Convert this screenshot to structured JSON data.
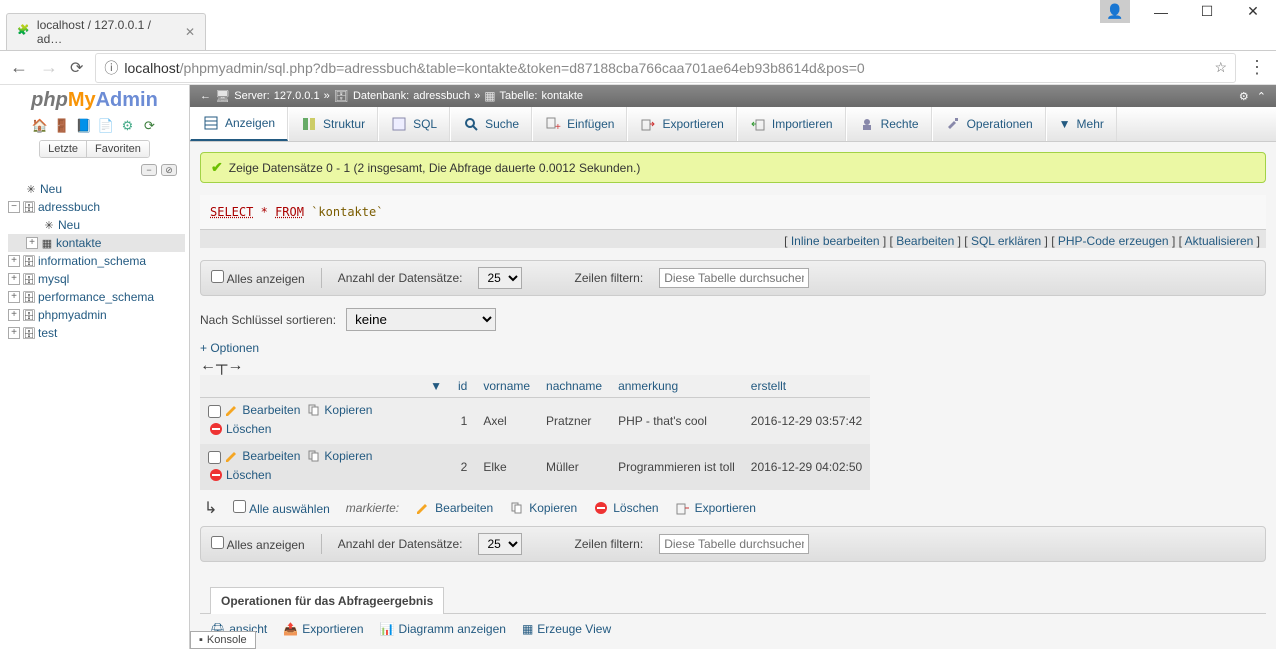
{
  "browser": {
    "tab_title": "localhost / 127.0.0.1 / ad…",
    "url_host": "localhost",
    "url_path": "/phpmyadmin/sql.php?db=adressbuch&table=kontakte&token=d87188cba766caa701ae64eb93b8614d&pos=0"
  },
  "sidebar": {
    "recent": "Letzte",
    "favorites": "Favoriten",
    "tree": [
      {
        "label": "Neu",
        "icon": "new",
        "indent": 0,
        "expander": ""
      },
      {
        "label": "adressbuch",
        "icon": "db",
        "indent": 0,
        "expander": "−"
      },
      {
        "label": "Neu",
        "icon": "new",
        "indent": 1,
        "expander": ""
      },
      {
        "label": "kontakte",
        "icon": "table",
        "indent": 1,
        "expander": "+",
        "selected": true
      },
      {
        "label": "information_schema",
        "icon": "db",
        "indent": 0,
        "expander": "+"
      },
      {
        "label": "mysql",
        "icon": "db",
        "indent": 0,
        "expander": "+"
      },
      {
        "label": "performance_schema",
        "icon": "db",
        "indent": 0,
        "expander": "+"
      },
      {
        "label": "phpmyadmin",
        "icon": "db",
        "indent": 0,
        "expander": "+"
      },
      {
        "label": "test",
        "icon": "db",
        "indent": 0,
        "expander": "+"
      }
    ]
  },
  "breadcrumb": {
    "server_lbl": "Server:",
    "server": "127.0.0.1",
    "db_lbl": "Datenbank:",
    "db": "adressbuch",
    "table_lbl": "Tabelle:",
    "table": "kontakte"
  },
  "tabs": {
    "browse": "Anzeigen",
    "structure": "Struktur",
    "sql": "SQL",
    "search": "Suche",
    "insert": "Einfügen",
    "export": "Exportieren",
    "import": "Importieren",
    "privileges": "Rechte",
    "operations": "Operationen",
    "more": "Mehr"
  },
  "success": "Zeige Datensätze 0 - 1 (2 insgesamt, Die Abfrage dauerte 0.0012 Sekunden.)",
  "sql_query": {
    "select": "SELECT",
    "star": "*",
    "from": "FROM",
    "table": "`kontakte`"
  },
  "sql_actions": {
    "inline": "Inline bearbeiten",
    "edit": "Bearbeiten",
    "explain": "SQL erklären",
    "php": "PHP-Code erzeugen",
    "refresh": "Aktualisieren"
  },
  "controls": {
    "show_all": "Alles anzeigen",
    "rows_label": "Anzahl der Datensätze:",
    "rows_value": "25",
    "filter_label": "Zeilen filtern:",
    "filter_placeholder": "Diese Tabelle durchsuchen",
    "sort_label": "Nach Schlüssel sortieren:",
    "sort_value": "keine",
    "options": "+ Optionen"
  },
  "table": {
    "headers": {
      "id": "id",
      "vorname": "vorname",
      "nachname": "nachname",
      "anmerkung": "anmerkung",
      "erstellt": "erstellt"
    },
    "actions": {
      "edit": "Bearbeiten",
      "copy": "Kopieren",
      "delete": "Löschen"
    },
    "rows": [
      {
        "id": "1",
        "vorname": "Axel",
        "nachname": "Pratzner",
        "anmerkung": "PHP - that's cool",
        "erstellt": "2016-12-29 03:57:42"
      },
      {
        "id": "2",
        "vorname": "Elke",
        "nachname": "Müller",
        "anmerkung": "Programmieren ist toll",
        "erstellt": "2016-12-29 04:02:50"
      }
    ]
  },
  "bulk": {
    "check_all": "Alle auswählen",
    "marked": "markierte:",
    "edit": "Bearbeiten",
    "copy": "Kopieren",
    "delete": "Löschen",
    "export": "Exportieren"
  },
  "result_ops": {
    "title": "Operationen für das Abfrageergebnis",
    "print": "ansicht",
    "export": "Exportieren",
    "chart": "Diagramm anzeigen",
    "view": "Erzeuge View"
  },
  "console": "Konsole"
}
